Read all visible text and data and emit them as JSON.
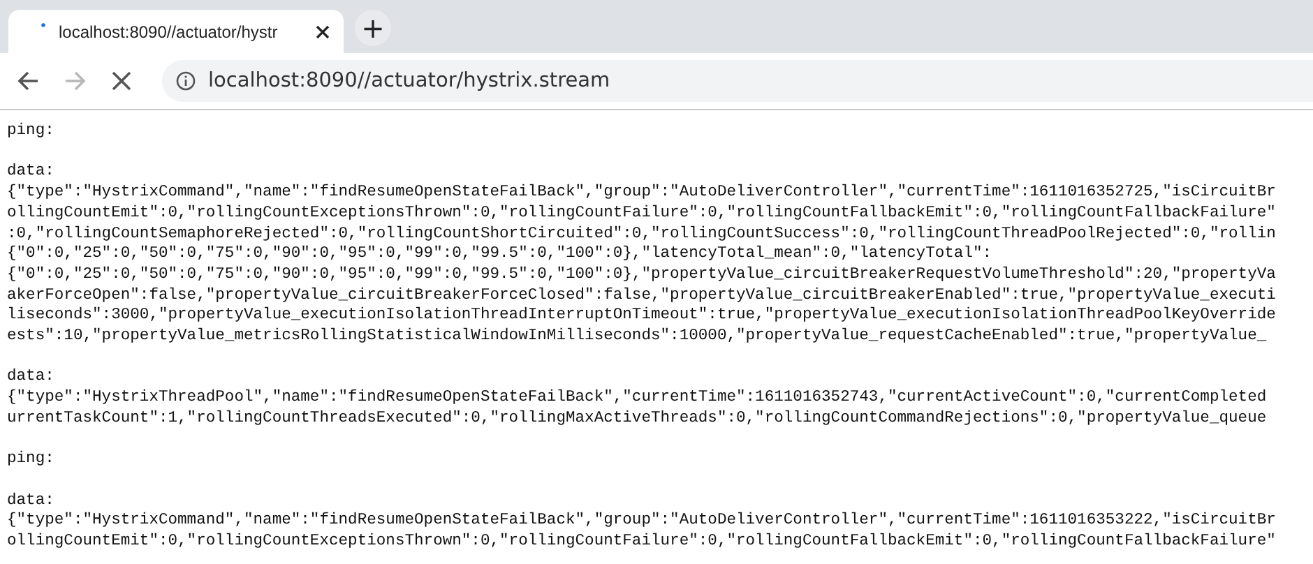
{
  "tabs": [
    {
      "title": "localhost:8090//actuator/hystr",
      "selected": true,
      "loading": true
    }
  ],
  "new_tab": "+",
  "nav": [
    {
      "kind": "back",
      "disabled": false
    },
    {
      "kind": "forward",
      "disabled": true
    },
    {
      "kind": "stop",
      "disabled": false
    }
  ],
  "address_bar": {
    "value": "localhost:8090//actuator/hystrix.stream"
  },
  "events": [
    {
      "label": "ping:"
    },
    {
      "label": "data:",
      "lines": [
        "{\"type\":\"HystrixCommand\",\"name\":\"findResumeOpenStateFailBack\",\"group\":\"AutoDeliverController\",\"currentTime\":1611016352725,\"isCircuitBr",
        "ollingCountEmit\":0,\"rollingCountExceptionsThrown\":0,\"rollingCountFailure\":0,\"rollingCountFallbackEmit\":0,\"rollingCountFallbackFailure\"",
        ":0,\"rollingCountSemaphoreRejected\":0,\"rollingCountShortCircuited\":0,\"rollingCountSuccess\":0,\"rollingCountThreadPoolRejected\":0,\"rollin",
        "{\"0\":0,\"25\":0,\"50\":0,\"75\":0,\"90\":0,\"95\":0,\"99\":0,\"99.5\":0,\"100\":0},\"latencyTotal_mean\":0,\"latencyTotal\":",
        "{\"0\":0,\"25\":0,\"50\":0,\"75\":0,\"90\":0,\"95\":0,\"99\":0,\"99.5\":0,\"100\":0},\"propertyValue_circuitBreakerRequestVolumeThreshold\":20,\"propertyVa",
        "akerForceOpen\":false,\"propertyValue_circuitBreakerForceClosed\":false,\"propertyValue_circuitBreakerEnabled\":true,\"propertyValue_executi",
        "liseconds\":3000,\"propertyValue_executionIsolationThreadInterruptOnTimeout\":true,\"propertyValue_executionIsolationThreadPoolKeyOverride",
        "ests\":10,\"propertyValue_metricsRollingStatisticalWindowInMilliseconds\":10000,\"propertyValue_requestCacheEnabled\":true,\"propertyValue_"
      ]
    },
    {
      "label": "data:",
      "lines": [
        "{\"type\":\"HystrixThreadPool\",\"name\":\"findResumeOpenStateFailBack\",\"currentTime\":1611016352743,\"currentActiveCount\":0,\"currentCompleted",
        "urrentTaskCount\":1,\"rollingCountThreadsExecuted\":0,\"rollingMaxActiveThreads\":0,\"rollingCountCommandRejections\":0,\"propertyValue_queue"
      ]
    },
    {
      "label": "ping:"
    },
    {
      "label": "data:",
      "lines": [
        "{\"type\":\"HystrixCommand\",\"name\":\"findResumeOpenStateFailBack\",\"group\":\"AutoDeliverController\",\"currentTime\":1611016353222,\"isCircuitBr",
        "ollingCountEmit\":0,\"rollingCountExceptionsThrown\":0,\"rollingCountFailure\":0,\"rollingCountFallbackEmit\":0,\"rollingCountFallbackFailure\""
      ]
    }
  ]
}
